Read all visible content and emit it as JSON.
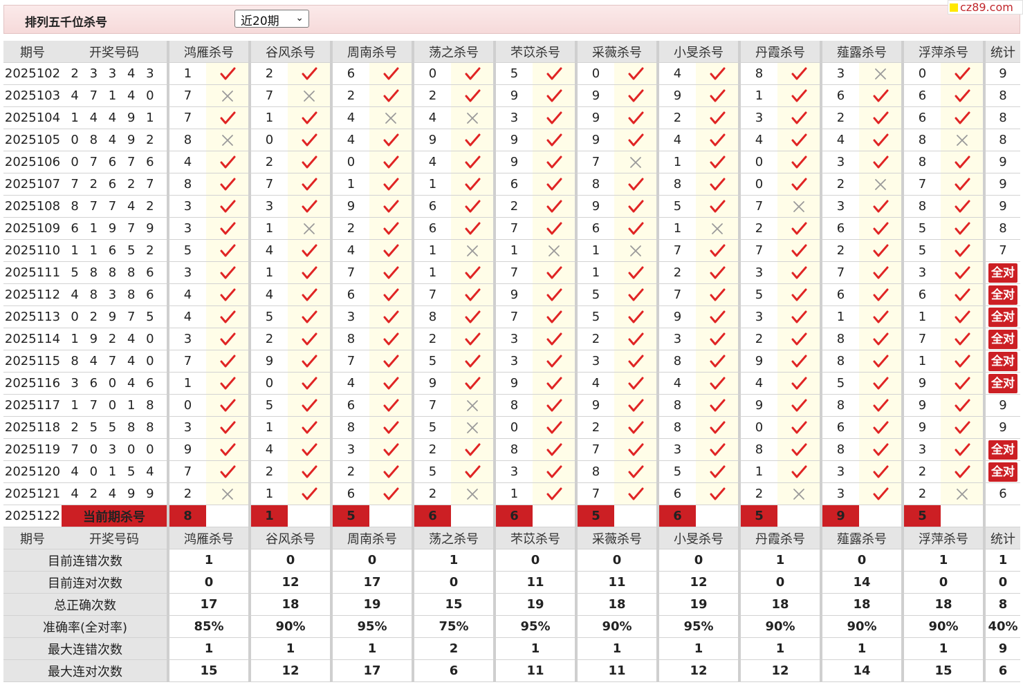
{
  "header": {
    "title": "排列五千位杀号",
    "period_select": "近20期",
    "site": "cz89.com"
  },
  "columns": {
    "issue": "期号",
    "draw": "开奖号码",
    "experts": [
      "鸿雁杀号",
      "谷风杀号",
      "周南杀号",
      "荡之杀号",
      "芣苡杀号",
      "采薇杀号",
      "小旻杀号",
      "丹霞杀号",
      "薤露杀号",
      "浮萍杀号"
    ],
    "total": "统计"
  },
  "rows": [
    {
      "issue": "2025102",
      "draw": "2 3 3 4 3",
      "kills": [
        [
          "1",
          "ok"
        ],
        [
          "2",
          "ok"
        ],
        [
          "6",
          "ok"
        ],
        [
          "0",
          "ok"
        ],
        [
          "5",
          "ok"
        ],
        [
          "0",
          "ok"
        ],
        [
          "4",
          "ok"
        ],
        [
          "8",
          "ok"
        ],
        [
          "3",
          "no"
        ],
        [
          "0",
          "ok"
        ]
      ],
      "total": "9"
    },
    {
      "issue": "2025103",
      "draw": "4 7 1 4 0",
      "kills": [
        [
          "7",
          "no"
        ],
        [
          "7",
          "no"
        ],
        [
          "2",
          "ok"
        ],
        [
          "2",
          "ok"
        ],
        [
          "9",
          "ok"
        ],
        [
          "9",
          "ok"
        ],
        [
          "9",
          "ok"
        ],
        [
          "1",
          "ok"
        ],
        [
          "6",
          "ok"
        ],
        [
          "6",
          "ok"
        ]
      ],
      "total": "8"
    },
    {
      "issue": "2025104",
      "draw": "1 4 4 9 1",
      "kills": [
        [
          "7",
          "ok"
        ],
        [
          "1",
          "ok"
        ],
        [
          "4",
          "no"
        ],
        [
          "4",
          "no"
        ],
        [
          "3",
          "ok"
        ],
        [
          "9",
          "ok"
        ],
        [
          "2",
          "ok"
        ],
        [
          "3",
          "ok"
        ],
        [
          "2",
          "ok"
        ],
        [
          "6",
          "ok"
        ]
      ],
      "total": "8"
    },
    {
      "issue": "2025105",
      "draw": "0 8 4 9 2",
      "kills": [
        [
          "8",
          "no"
        ],
        [
          "0",
          "ok"
        ],
        [
          "4",
          "ok"
        ],
        [
          "9",
          "ok"
        ],
        [
          "9",
          "ok"
        ],
        [
          "9",
          "ok"
        ],
        [
          "4",
          "ok"
        ],
        [
          "4",
          "ok"
        ],
        [
          "4",
          "ok"
        ],
        [
          "8",
          "no"
        ]
      ],
      "total": "8"
    },
    {
      "issue": "2025106",
      "draw": "0 7 6 7 6",
      "kills": [
        [
          "4",
          "ok"
        ],
        [
          "2",
          "ok"
        ],
        [
          "0",
          "ok"
        ],
        [
          "4",
          "ok"
        ],
        [
          "9",
          "ok"
        ],
        [
          "7",
          "no"
        ],
        [
          "1",
          "ok"
        ],
        [
          "0",
          "ok"
        ],
        [
          "3",
          "ok"
        ],
        [
          "8",
          "ok"
        ]
      ],
      "total": "9"
    },
    {
      "issue": "2025107",
      "draw": "7 2 6 2 7",
      "kills": [
        [
          "8",
          "ok"
        ],
        [
          "7",
          "ok"
        ],
        [
          "1",
          "ok"
        ],
        [
          "1",
          "ok"
        ],
        [
          "6",
          "ok"
        ],
        [
          "8",
          "ok"
        ],
        [
          "8",
          "ok"
        ],
        [
          "0",
          "ok"
        ],
        [
          "2",
          "no"
        ],
        [
          "7",
          "ok"
        ]
      ],
      "total": "9"
    },
    {
      "issue": "2025108",
      "draw": "8 7 7 4 2",
      "kills": [
        [
          "3",
          "ok"
        ],
        [
          "3",
          "ok"
        ],
        [
          "9",
          "ok"
        ],
        [
          "6",
          "ok"
        ],
        [
          "2",
          "ok"
        ],
        [
          "9",
          "ok"
        ],
        [
          "5",
          "ok"
        ],
        [
          "7",
          "no"
        ],
        [
          "3",
          "ok"
        ],
        [
          "8",
          "ok"
        ]
      ],
      "total": "9"
    },
    {
      "issue": "2025109",
      "draw": "6 1 9 7 9",
      "kills": [
        [
          "3",
          "ok"
        ],
        [
          "1",
          "no"
        ],
        [
          "2",
          "ok"
        ],
        [
          "6",
          "ok"
        ],
        [
          "7",
          "ok"
        ],
        [
          "6",
          "ok"
        ],
        [
          "1",
          "no"
        ],
        [
          "2",
          "ok"
        ],
        [
          "6",
          "ok"
        ],
        [
          "5",
          "ok"
        ]
      ],
      "total": "8"
    },
    {
      "issue": "2025110",
      "draw": "1 1 6 5 2",
      "kills": [
        [
          "5",
          "ok"
        ],
        [
          "4",
          "ok"
        ],
        [
          "4",
          "ok"
        ],
        [
          "1",
          "no"
        ],
        [
          "1",
          "no"
        ],
        [
          "1",
          "no"
        ],
        [
          "7",
          "ok"
        ],
        [
          "7",
          "ok"
        ],
        [
          "2",
          "ok"
        ],
        [
          "5",
          "ok"
        ]
      ],
      "total": "7"
    },
    {
      "issue": "2025111",
      "draw": "5 8 8 8 6",
      "kills": [
        [
          "3",
          "ok"
        ],
        [
          "1",
          "ok"
        ],
        [
          "7",
          "ok"
        ],
        [
          "1",
          "ok"
        ],
        [
          "7",
          "ok"
        ],
        [
          "1",
          "ok"
        ],
        [
          "2",
          "ok"
        ],
        [
          "3",
          "ok"
        ],
        [
          "7",
          "ok"
        ],
        [
          "3",
          "ok"
        ]
      ],
      "total": "全对"
    },
    {
      "issue": "2025112",
      "draw": "4 8 3 8 6",
      "kills": [
        [
          "4",
          "ok"
        ],
        [
          "4",
          "ok"
        ],
        [
          "6",
          "ok"
        ],
        [
          "7",
          "ok"
        ],
        [
          "9",
          "ok"
        ],
        [
          "5",
          "ok"
        ],
        [
          "7",
          "ok"
        ],
        [
          "5",
          "ok"
        ],
        [
          "6",
          "ok"
        ],
        [
          "6",
          "ok"
        ]
      ],
      "total": "全对"
    },
    {
      "issue": "2025113",
      "draw": "0 2 9 7 5",
      "kills": [
        [
          "4",
          "ok"
        ],
        [
          "5",
          "ok"
        ],
        [
          "3",
          "ok"
        ],
        [
          "8",
          "ok"
        ],
        [
          "7",
          "ok"
        ],
        [
          "5",
          "ok"
        ],
        [
          "9",
          "ok"
        ],
        [
          "3",
          "ok"
        ],
        [
          "1",
          "ok"
        ],
        [
          "1",
          "ok"
        ]
      ],
      "total": "全对"
    },
    {
      "issue": "2025114",
      "draw": "1 9 2 4 0",
      "kills": [
        [
          "3",
          "ok"
        ],
        [
          "2",
          "ok"
        ],
        [
          "8",
          "ok"
        ],
        [
          "2",
          "ok"
        ],
        [
          "3",
          "ok"
        ],
        [
          "2",
          "ok"
        ],
        [
          "3",
          "ok"
        ],
        [
          "2",
          "ok"
        ],
        [
          "8",
          "ok"
        ],
        [
          "7",
          "ok"
        ]
      ],
      "total": "全对"
    },
    {
      "issue": "2025115",
      "draw": "8 4 7 4 0",
      "kills": [
        [
          "7",
          "ok"
        ],
        [
          "9",
          "ok"
        ],
        [
          "7",
          "ok"
        ],
        [
          "5",
          "ok"
        ],
        [
          "3",
          "ok"
        ],
        [
          "3",
          "ok"
        ],
        [
          "8",
          "ok"
        ],
        [
          "9",
          "ok"
        ],
        [
          "8",
          "ok"
        ],
        [
          "1",
          "ok"
        ]
      ],
      "total": "全对"
    },
    {
      "issue": "2025116",
      "draw": "3 6 0 4 6",
      "kills": [
        [
          "1",
          "ok"
        ],
        [
          "0",
          "ok"
        ],
        [
          "4",
          "ok"
        ],
        [
          "9",
          "ok"
        ],
        [
          "9",
          "ok"
        ],
        [
          "4",
          "ok"
        ],
        [
          "4",
          "ok"
        ],
        [
          "4",
          "ok"
        ],
        [
          "5",
          "ok"
        ],
        [
          "9",
          "ok"
        ]
      ],
      "total": "全对"
    },
    {
      "issue": "2025117",
      "draw": "1 7 0 1 8",
      "kills": [
        [
          "0",
          "ok"
        ],
        [
          "5",
          "ok"
        ],
        [
          "6",
          "ok"
        ],
        [
          "7",
          "no"
        ],
        [
          "8",
          "ok"
        ],
        [
          "9",
          "ok"
        ],
        [
          "8",
          "ok"
        ],
        [
          "9",
          "ok"
        ],
        [
          "8",
          "ok"
        ],
        [
          "9",
          "ok"
        ]
      ],
      "total": "9"
    },
    {
      "issue": "2025118",
      "draw": "2 5 5 8 8",
      "kills": [
        [
          "3",
          "ok"
        ],
        [
          "1",
          "ok"
        ],
        [
          "8",
          "ok"
        ],
        [
          "5",
          "no"
        ],
        [
          "0",
          "ok"
        ],
        [
          "2",
          "ok"
        ],
        [
          "8",
          "ok"
        ],
        [
          "0",
          "ok"
        ],
        [
          "6",
          "ok"
        ],
        [
          "9",
          "ok"
        ]
      ],
      "total": "9"
    },
    {
      "issue": "2025119",
      "draw": "7 0 3 0 0",
      "kills": [
        [
          "9",
          "ok"
        ],
        [
          "4",
          "ok"
        ],
        [
          "3",
          "ok"
        ],
        [
          "2",
          "ok"
        ],
        [
          "8",
          "ok"
        ],
        [
          "7",
          "ok"
        ],
        [
          "3",
          "ok"
        ],
        [
          "8",
          "ok"
        ],
        [
          "8",
          "ok"
        ],
        [
          "3",
          "ok"
        ]
      ],
      "total": "全对"
    },
    {
      "issue": "2025120",
      "draw": "4 0 1 5 4",
      "kills": [
        [
          "7",
          "ok"
        ],
        [
          "2",
          "ok"
        ],
        [
          "2",
          "ok"
        ],
        [
          "5",
          "ok"
        ],
        [
          "3",
          "ok"
        ],
        [
          "8",
          "ok"
        ],
        [
          "5",
          "ok"
        ],
        [
          "1",
          "ok"
        ],
        [
          "3",
          "ok"
        ],
        [
          "2",
          "ok"
        ]
      ],
      "total": "全对"
    },
    {
      "issue": "2025121",
      "draw": "4 2 4 9 9",
      "kills": [
        [
          "2",
          "no"
        ],
        [
          "1",
          "ok"
        ],
        [
          "6",
          "ok"
        ],
        [
          "2",
          "no"
        ],
        [
          "1",
          "ok"
        ],
        [
          "7",
          "ok"
        ],
        [
          "6",
          "ok"
        ],
        [
          "2",
          "no"
        ],
        [
          "3",
          "ok"
        ],
        [
          "2",
          "no"
        ]
      ],
      "total": "6"
    }
  ],
  "current": {
    "issue": "2025122",
    "label": "当前期杀号",
    "kills": [
      "8",
      "1",
      "5",
      "6",
      "6",
      "5",
      "6",
      "5",
      "9",
      "5"
    ]
  },
  "stats": [
    {
      "label": "目前连错次数",
      "values": [
        "1",
        "0",
        "0",
        "1",
        "0",
        "0",
        "0",
        "1",
        "0",
        "1"
      ],
      "total": "1",
      "kind": "val"
    },
    {
      "label": "目前连对次数",
      "values": [
        "0",
        "12",
        "17",
        "0",
        "11",
        "11",
        "12",
        "0",
        "14",
        "0"
      ],
      "total": "0",
      "kind": "val"
    },
    {
      "label": "总正确次数",
      "values": [
        "17",
        "18",
        "19",
        "15",
        "19",
        "18",
        "19",
        "18",
        "18",
        "18"
      ],
      "total": "8",
      "kind": "val"
    },
    {
      "label": "准确率(全对率)",
      "values": [
        "85%",
        "90%",
        "95%",
        "75%",
        "95%",
        "90%",
        "95%",
        "90%",
        "90%",
        "90%"
      ],
      "total": "40%",
      "kind": "rate"
    },
    {
      "label": "最大连错次数",
      "values": [
        "1",
        "1",
        "1",
        "2",
        "1",
        "1",
        "1",
        "1",
        "1",
        "1"
      ],
      "total": "9",
      "kind": "val"
    },
    {
      "label": "最大连对次数",
      "values": [
        "15",
        "12",
        "17",
        "6",
        "11",
        "11",
        "12",
        "12",
        "14",
        "15"
      ],
      "total": "6",
      "kind": "val"
    }
  ],
  "icons": {
    "ok": "check-icon",
    "no": "cross-icon"
  },
  "colors": {
    "accent_red": "#cc1f24",
    "stat_blue": "#1f1fc8",
    "draw_red": "#c0262b",
    "mark_bg": "#fffde8"
  }
}
